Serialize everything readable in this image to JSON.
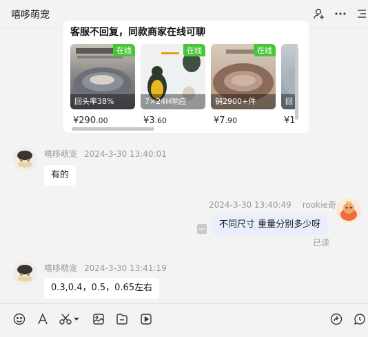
{
  "header": {
    "title": "嘻哆萌宠"
  },
  "card": {
    "title": "客服不回复，同款商家在线可聊",
    "products": [
      {
        "badge": "在线",
        "overlay": "回头率38%",
        "price_symbol": "¥",
        "price_int": "290",
        "price_dec": ".00",
        "img_color": "#7a7f88"
      },
      {
        "badge": "在线",
        "overlay": "7×24H响应",
        "price_symbol": "¥",
        "price_int": "3",
        "price_dec": ".60",
        "img_color": "#eef0f2"
      },
      {
        "badge": "在线",
        "overlay": "销2900+件",
        "price_symbol": "¥",
        "price_int": "7",
        "price_dec": ".90",
        "img_color": "#b89a84"
      },
      {
        "badge": "",
        "overlay": "回",
        "price_symbol": "¥",
        "price_int": "1",
        "price_dec": "",
        "img_color": "#9aa7b0"
      }
    ]
  },
  "messages": [
    {
      "sender": "嘻哆萌宠",
      "time": "2024-3-30 13:40:01",
      "text": "有的"
    },
    {
      "sender": "rookie奇",
      "time": "2024-3-30 13:40:49",
      "text": "不同尺寸 重量分别多少呀",
      "status": "已读"
    },
    {
      "sender": "嘻哆萌宠",
      "time": "2024-3-30 13:41:19",
      "text": "0.3,0.4，0.5，0.65左右"
    }
  ]
}
